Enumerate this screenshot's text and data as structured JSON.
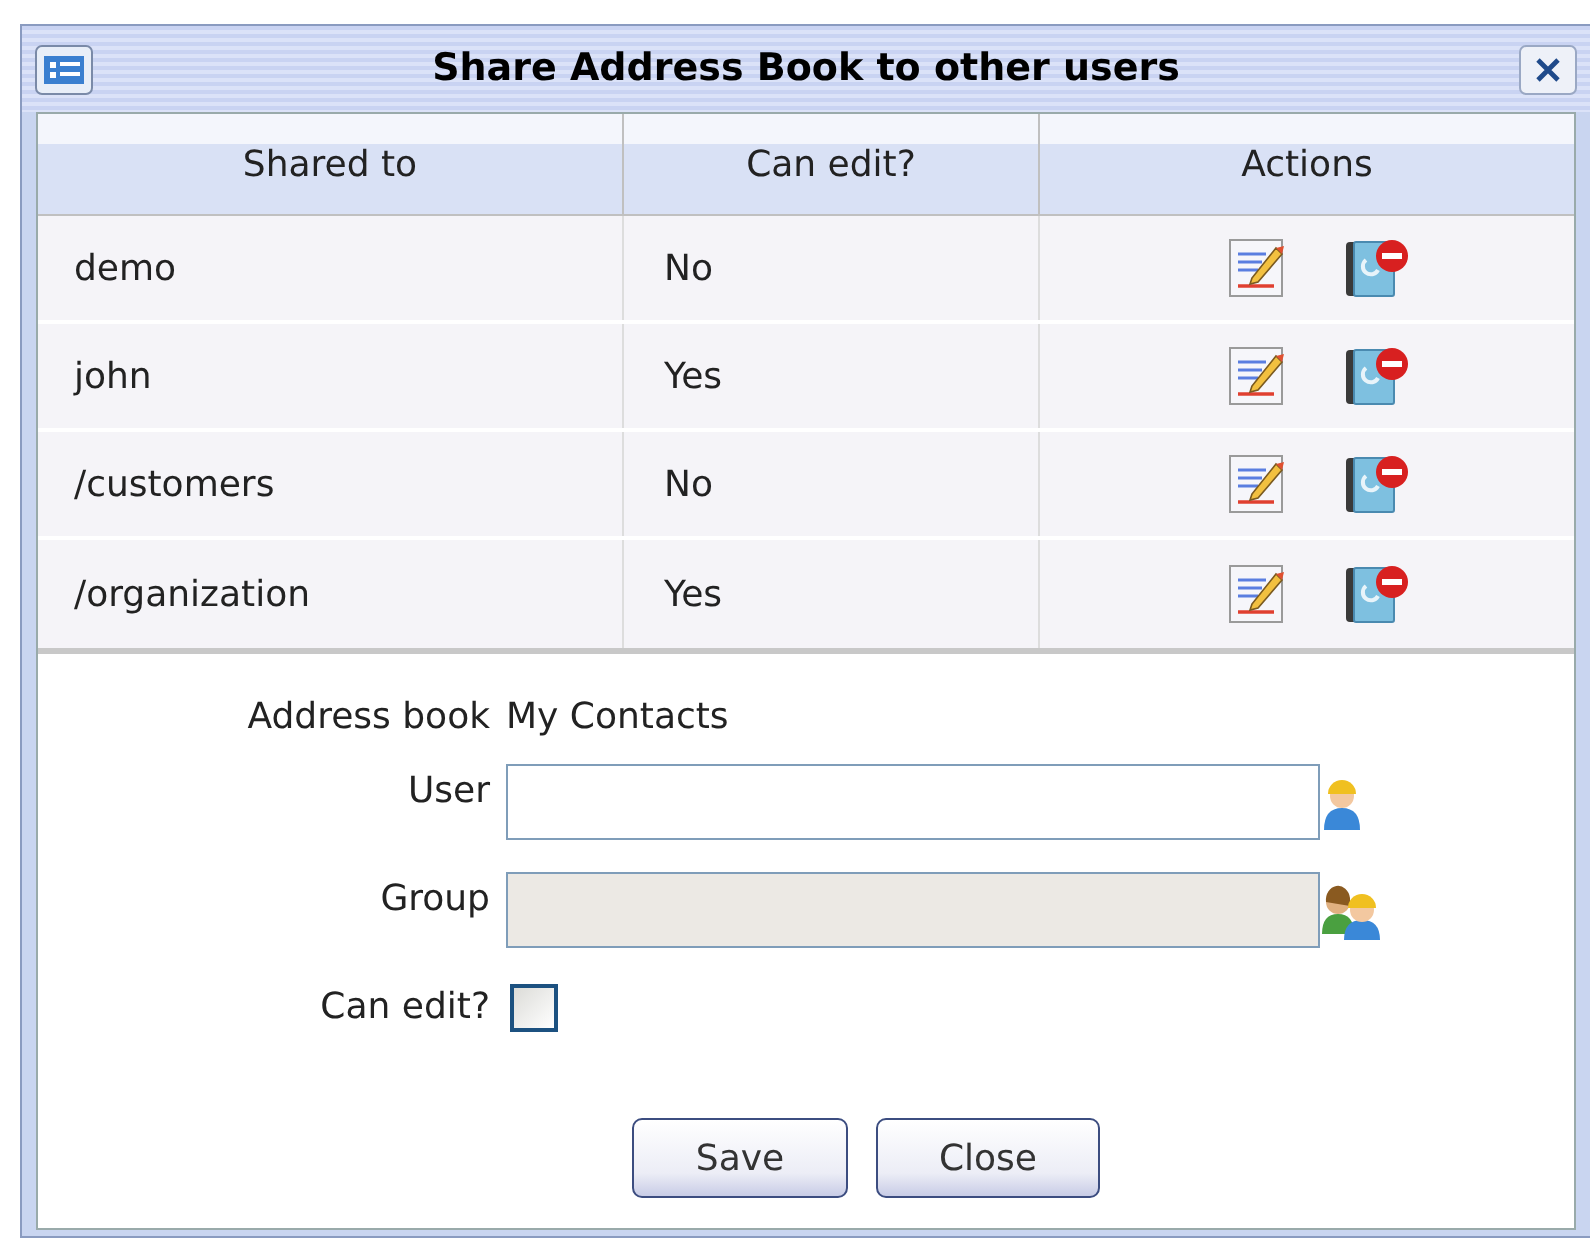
{
  "window": {
    "title": "Share Address Book to other users"
  },
  "table": {
    "columns": [
      "Shared to",
      "Can edit?",
      "Actions"
    ],
    "rows": [
      {
        "shared_to": "demo",
        "can_edit": "No"
      },
      {
        "shared_to": "john",
        "can_edit": "Yes"
      },
      {
        "shared_to": "/customers",
        "can_edit": "No"
      },
      {
        "shared_to": "/organization",
        "can_edit": "Yes"
      }
    ]
  },
  "form": {
    "address_book_label": "Address book",
    "address_book_value": "My Contacts",
    "user": {
      "label": "User",
      "disabled": false
    },
    "group": {
      "label": "Group",
      "disabled": true
    },
    "can_edit": {
      "label": "Can edit?",
      "checked": false
    }
  },
  "buttons": [
    "Save",
    "Close"
  ]
}
